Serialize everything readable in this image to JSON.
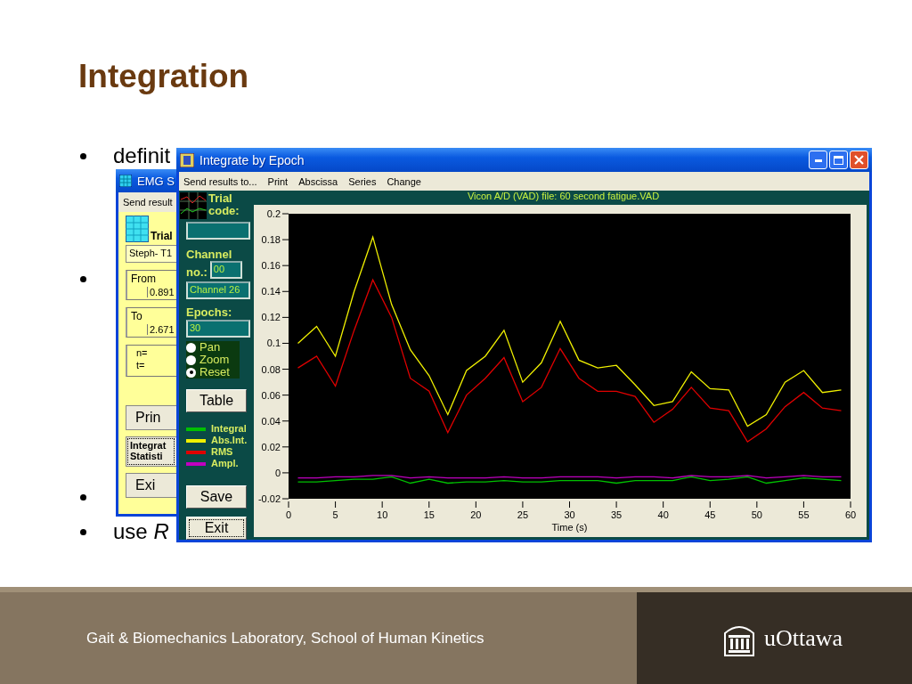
{
  "slide": {
    "title": "Integration",
    "bullets": [
      {
        "kind": "text",
        "text": "definit"
      },
      {
        "kind": "covered"
      },
      {
        "kind": "covered"
      },
      {
        "kind": "text",
        "text": "use *R*"
      }
    ]
  },
  "emg_window": {
    "title": "EMG S",
    "menu": [
      "Send result"
    ],
    "trial_label": "Trial",
    "trial_value": "Steph- T1",
    "from_label": "From",
    "from_value": "0.891",
    "to_label": "To",
    "to_value": "2.671",
    "n_label": "n=",
    "t_label": "t=",
    "buttons": [
      {
        "lines": [
          "Prin"
        ],
        "focused": false
      },
      {
        "lines": [
          "Integrat",
          "Statisti"
        ],
        "focused": true
      },
      {
        "lines": [
          "Exi"
        ],
        "focused": false
      }
    ]
  },
  "integrate_window": {
    "title": "Integrate by Epoch",
    "menu": [
      "Send results to...",
      "Print",
      "Abscissa",
      "Series",
      "Change"
    ],
    "trial_code_lines": [
      "Trial",
      "code:"
    ],
    "channel_lines": [
      "Channel",
      "no.:"
    ],
    "channel_no": "00",
    "channel_name": "Channel 26",
    "epochs_label": "Epochs:",
    "epochs": "30",
    "modes": [
      {
        "label": "Pan",
        "selected": false
      },
      {
        "label": "Zoom",
        "selected": false
      },
      {
        "label": "Reset",
        "selected": true
      }
    ],
    "buttons": [
      {
        "label": "Table",
        "focused": false
      },
      {
        "label": "Save",
        "focused": false
      },
      {
        "label": "Exit",
        "focused": true
      }
    ],
    "chart_data": {
      "type": "line",
      "title": "Vicon A/D (VAD) file: 60 second fatigue.VAD",
      "xlabel": "Time (s)",
      "x": [
        1,
        3,
        5,
        7,
        9,
        11,
        13,
        15,
        17,
        19,
        21,
        23,
        25,
        27,
        29,
        31,
        33,
        35,
        37,
        39,
        41,
        43,
        45,
        47,
        49,
        51,
        53,
        55,
        57,
        59
      ],
      "xlim": [
        0,
        60
      ],
      "ylim": [
        -0.02,
        0.2
      ],
      "xticks": [
        0,
        5,
        10,
        15,
        20,
        25,
        30,
        35,
        40,
        45,
        50,
        55,
        60
      ],
      "yticks": [
        -0.02,
        0,
        0.02,
        0.04,
        0.06,
        0.08,
        0.1,
        0.12,
        0.14,
        0.16,
        0.18,
        0.2
      ],
      "series": [
        {
          "name": "Integral",
          "color": "#00c000",
          "values": [
            -0.007,
            -0.007,
            -0.006,
            -0.005,
            -0.005,
            -0.003,
            -0.008,
            -0.005,
            -0.008,
            -0.007,
            -0.007,
            -0.006,
            -0.007,
            -0.007,
            -0.006,
            -0.006,
            -0.006,
            -0.008,
            -0.006,
            -0.006,
            -0.006,
            -0.003,
            -0.006,
            -0.005,
            -0.003,
            -0.008,
            -0.006,
            -0.004,
            -0.005,
            -0.006
          ]
        },
        {
          "name": "Abs.Int.",
          "color": "#f0f000",
          "values": [
            0.1,
            0.113,
            0.09,
            0.14,
            0.182,
            0.13,
            0.095,
            0.075,
            0.045,
            0.079,
            0.09,
            0.11,
            0.07,
            0.085,
            0.117,
            0.087,
            0.081,
            0.083,
            0.068,
            0.052,
            0.055,
            0.078,
            0.065,
            0.064,
            0.036,
            0.045,
            0.07,
            0.079,
            0.062,
            0.064
          ]
        },
        {
          "name": "RMS",
          "color": "#e00000",
          "values": [
            0.081,
            0.09,
            0.067,
            0.11,
            0.149,
            0.12,
            0.073,
            0.063,
            0.031,
            0.06,
            0.073,
            0.089,
            0.055,
            0.066,
            0.096,
            0.073,
            0.063,
            0.063,
            0.059,
            0.039,
            0.049,
            0.066,
            0.05,
            0.048,
            0.024,
            0.034,
            0.051,
            0.062,
            0.05,
            0.048
          ]
        },
        {
          "name": "Ampl.",
          "color": "#c000c0",
          "values": [
            -0.004,
            -0.004,
            -0.003,
            -0.003,
            -0.002,
            -0.002,
            -0.004,
            -0.003,
            -0.004,
            -0.004,
            -0.004,
            -0.003,
            -0.004,
            -0.004,
            -0.003,
            -0.003,
            -0.003,
            -0.004,
            -0.003,
            -0.003,
            -0.004,
            -0.002,
            -0.003,
            -0.003,
            -0.002,
            -0.004,
            -0.003,
            -0.002,
            -0.003,
            -0.003
          ]
        }
      ]
    }
  },
  "footer": {
    "text": "Gait & Biomechanics Laboratory, School of Human Kinetics",
    "logo_text": "uOttawa"
  }
}
